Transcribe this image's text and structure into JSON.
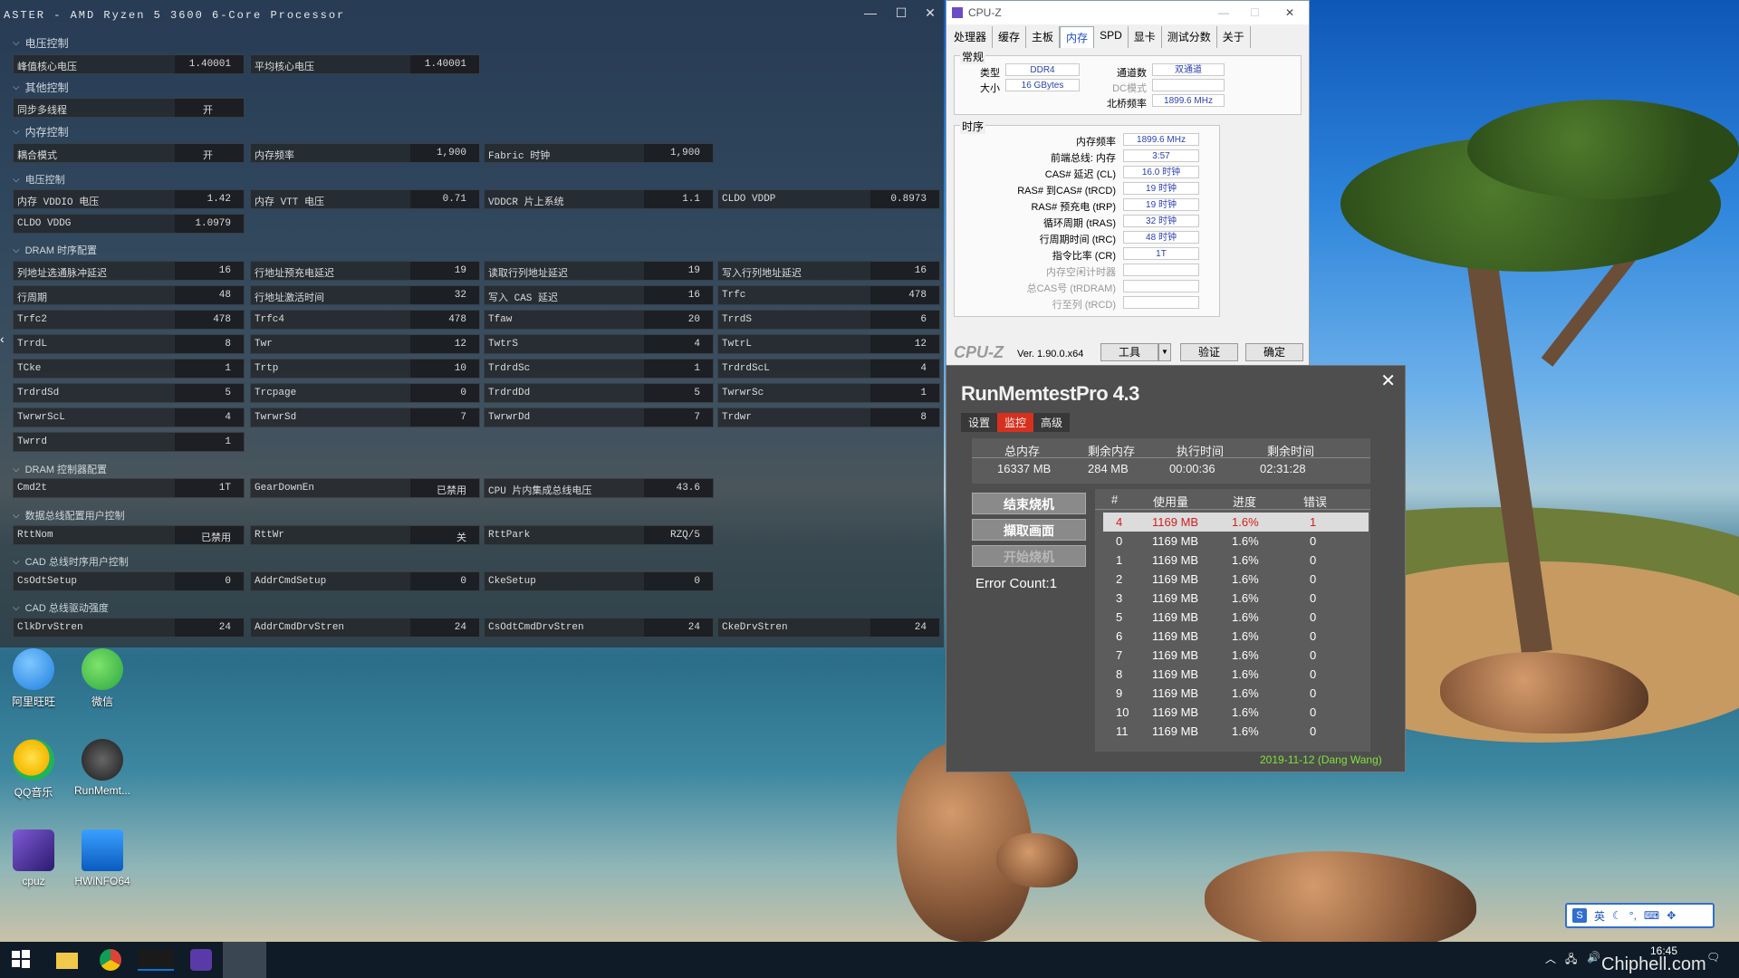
{
  "ryzen_master": {
    "title": "ASTER - AMD Ryzen 5 3600 6-Core Processor",
    "sections": {
      "voltage": "电压控制",
      "other": "其他控制",
      "memory": "内存控制",
      "power": "电压控制",
      "dram_timing": "DRAM 时序配置",
      "dram_ctrl": "DRAM 控制器配置",
      "data_bus": "数据总线配置用户控制",
      "cad_timing": "CAD 总线时序用户控制",
      "cad_drive": "CAD 总线驱动强度"
    },
    "cells": {
      "peak_core_v": {
        "label": "峰值核心电压",
        "value": "1.40001"
      },
      "avg_core_v": {
        "label": "平均核心电压",
        "value": "1.40001"
      },
      "smt": {
        "label": "同步多线程",
        "value": "开"
      },
      "coupled": {
        "label": "耦合模式",
        "value": "开"
      },
      "mem_clock": {
        "label": "内存频率",
        "value": "1,900"
      },
      "fabric": {
        "label": "Fabric 时钟",
        "value": "1,900"
      },
      "vddio": {
        "label": "内存 VDDIO 电压",
        "value": "1.42"
      },
      "vtt": {
        "label": "内存 VTT 电压",
        "value": "0.71"
      },
      "vddcr": {
        "label": "VDDCR 片上系统",
        "value": "1.1"
      },
      "cldo_vddp": {
        "label": "CLDO VDDP",
        "value": "0.8973"
      },
      "cldo_vddg": {
        "label": "CLDO VDDG",
        "value": "1.0979"
      }
    },
    "timings": [
      [
        [
          "列地址选通脉冲延迟",
          "16"
        ],
        [
          "行地址预充电延迟",
          "19"
        ],
        [
          "读取行列地址延迟",
          "19"
        ],
        [
          "写入行列地址延迟",
          "16"
        ]
      ],
      [
        [
          "行周期",
          "48"
        ],
        [
          "行地址激活时间",
          "32"
        ],
        [
          "写入 CAS 延迟",
          "16"
        ],
        [
          "Trfc",
          "478"
        ]
      ],
      [
        [
          "Trfc2",
          "478"
        ],
        [
          "Trfc4",
          "478"
        ],
        [
          "Tfaw",
          "20"
        ],
        [
          "TrrdS",
          "6"
        ]
      ],
      [
        [
          "TrrdL",
          "8"
        ],
        [
          "Twr",
          "12"
        ],
        [
          "TwtrS",
          "4"
        ],
        [
          "TwtrL",
          "12"
        ]
      ],
      [
        [
          "TCke",
          "1"
        ],
        [
          "Trtp",
          "10"
        ],
        [
          "TrdrdSc",
          "1"
        ],
        [
          "TrdrdScL",
          "4"
        ]
      ],
      [
        [
          "TrdrdSd",
          "5"
        ],
        [
          "Trcpage",
          "0"
        ],
        [
          "TrdrdDd",
          "5"
        ],
        [
          "TwrwrSc",
          "1"
        ]
      ],
      [
        [
          "TwrwrScL",
          "4"
        ],
        [
          "TwrwrSd",
          "7"
        ],
        [
          "TwrwrDd",
          "7"
        ],
        [
          "Trdwr",
          "8"
        ]
      ],
      [
        [
          "Twrrd",
          "1"
        ]
      ]
    ],
    "ctrl": [
      [
        "Cmd2t",
        "1T"
      ],
      [
        "GearDownEn",
        "已禁用"
      ],
      [
        "CPU 片内集成总线电压",
        "43.6"
      ]
    ],
    "bus": [
      [
        "RttNom",
        "已禁用"
      ],
      [
        "RttWr",
        "关"
      ],
      [
        "RttPark",
        "RZQ/5"
      ]
    ],
    "cadt": [
      [
        "CsOdtSetup",
        "0"
      ],
      [
        "AddrCmdSetup",
        "0"
      ],
      [
        "CkeSetup",
        "0"
      ]
    ],
    "cadd": [
      [
        "ClkDrvStren",
        "24"
      ],
      [
        "AddrCmdDrvStren",
        "24"
      ],
      [
        "CsOdtCmdDrvStren",
        "24"
      ],
      [
        "CkeDrvStren",
        "24"
      ]
    ]
  },
  "desktop_icons": [
    "阿里旺旺",
    "微信",
    "QQ音乐",
    "RunMemt...",
    "cpuz",
    "HWiNFO64"
  ],
  "cpuz": {
    "title": "CPU-Z",
    "tabs": [
      "处理器",
      "缓存",
      "主板",
      "内存",
      "SPD",
      "显卡",
      "测试分数",
      "关于"
    ],
    "general_title": "常规",
    "type_label": "类型",
    "type_value": "DDR4",
    "size_label": "大小",
    "size_value": "16 GBytes",
    "channels_label": "通道数",
    "channels_value": "双通道",
    "dc_label": "DC模式",
    "dc_value": "",
    "nb_label": "北桥频率",
    "nb_value": "1899.6 MHz",
    "timing_title": "时序",
    "timings": [
      [
        "内存频率",
        "1899.6 MHz"
      ],
      [
        "前端总线: 内存",
        "3:57"
      ],
      [
        "CAS# 延迟 (CL)",
        "16.0 时钟"
      ],
      [
        "RAS# 到CAS# (tRCD)",
        "19 时钟"
      ],
      [
        "RAS# 预充电 (tRP)",
        "19 时钟"
      ],
      [
        "循环周期 (tRAS)",
        "32 时钟"
      ],
      [
        "行周期时间 (tRC)",
        "48 时钟"
      ],
      [
        "指令比率 (CR)",
        "1T"
      ],
      [
        "内存空闲计时器",
        ""
      ],
      [
        "总CAS号 (tRDRAM)",
        ""
      ],
      [
        "行至列 (tRCD)",
        ""
      ]
    ],
    "brand": "CPU-Z",
    "version": "Ver. 1.90.0.x64",
    "tools": "工具",
    "validate": "验证",
    "ok": "确定"
  },
  "runmemtest": {
    "title": "RunMemtestPro 4.3",
    "tabs": [
      "设置",
      "监控",
      "高级"
    ],
    "summary_headers": [
      "总内存",
      "剩余内存",
      "执行时间",
      "剩余时间"
    ],
    "summary_values": [
      "16337 MB",
      "284 MB",
      "00:00:36",
      "02:31:28"
    ],
    "buttons": [
      "结束烧机",
      "擷取画面",
      "开始烧机"
    ],
    "error_count": "Error Count:1",
    "table_headers": [
      "#",
      "使用量",
      "进度",
      "错误"
    ],
    "rows": [
      [
        "4",
        "1169 MB",
        "1.6%",
        "1"
      ],
      [
        "0",
        "1169 MB",
        "1.6%",
        "0"
      ],
      [
        "1",
        "1169 MB",
        "1.6%",
        "0"
      ],
      [
        "2",
        "1169 MB",
        "1.6%",
        "0"
      ],
      [
        "3",
        "1169 MB",
        "1.6%",
        "0"
      ],
      [
        "5",
        "1169 MB",
        "1.6%",
        "0"
      ],
      [
        "6",
        "1169 MB",
        "1.6%",
        "0"
      ],
      [
        "7",
        "1169 MB",
        "1.6%",
        "0"
      ],
      [
        "8",
        "1169 MB",
        "1.6%",
        "0"
      ],
      [
        "9",
        "1169 MB",
        "1.6%",
        "0"
      ],
      [
        "10",
        "1169 MB",
        "1.6%",
        "0"
      ],
      [
        "11",
        "1169 MB",
        "1.6%",
        "0"
      ]
    ],
    "footer": "2019-11-12 (Dang Wang)"
  },
  "ime": {
    "lang": "英"
  },
  "taskbar": {
    "time": "16:45",
    "watermark": "Chiphell.com",
    "accent": "#0078d7"
  }
}
